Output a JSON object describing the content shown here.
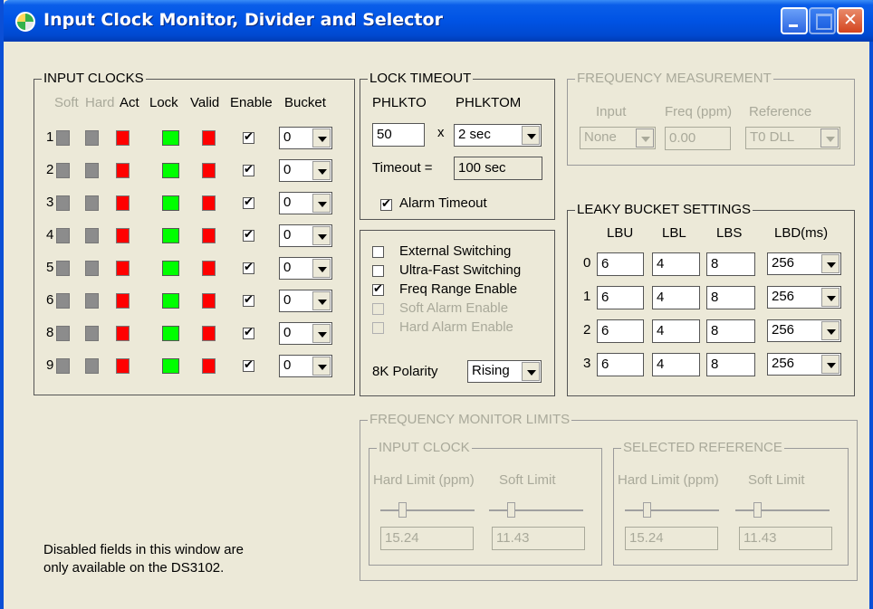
{
  "window": {
    "title": "Input Clock Monitor, Divider and Selector",
    "accent": "#0054e3",
    "face_color": "#ece9d8"
  },
  "input_clocks": {
    "label": "INPUT CLOCKS",
    "headers": [
      "Soft",
      "Hard",
      "Act",
      "Lock",
      "Valid",
      "Enable",
      "Bucket"
    ],
    "rows": [
      {
        "num": "1",
        "soft": "gray",
        "hard": "gray",
        "act": "red",
        "lock": "green",
        "valid": "red",
        "enable": true,
        "bucket": "0"
      },
      {
        "num": "2",
        "soft": "gray",
        "hard": "gray",
        "act": "red",
        "lock": "green",
        "valid": "red",
        "enable": true,
        "bucket": "0"
      },
      {
        "num": "3",
        "soft": "gray",
        "hard": "gray",
        "act": "red",
        "lock": "green",
        "valid": "red",
        "enable": true,
        "bucket": "0"
      },
      {
        "num": "4",
        "soft": "gray",
        "hard": "gray",
        "act": "red",
        "lock": "green",
        "valid": "red",
        "enable": true,
        "bucket": "0"
      },
      {
        "num": "5",
        "soft": "gray",
        "hard": "gray",
        "act": "red",
        "lock": "green",
        "valid": "red",
        "enable": true,
        "bucket": "0"
      },
      {
        "num": "6",
        "soft": "gray",
        "hard": "gray",
        "act": "red",
        "lock": "green",
        "valid": "red",
        "enable": true,
        "bucket": "0"
      },
      {
        "num": "8",
        "soft": "gray",
        "hard": "gray",
        "act": "red",
        "lock": "green",
        "valid": "red",
        "enable": true,
        "bucket": "0"
      },
      {
        "num": "9",
        "soft": "gray",
        "hard": "gray",
        "act": "red",
        "lock": "green",
        "valid": "red",
        "enable": true,
        "bucket": "0"
      }
    ]
  },
  "lock_timeout": {
    "label": "LOCK TIMEOUT",
    "phlkto_label": "PHLKTO",
    "phlktom_label": "PHLKTOM",
    "phlkto_value": "50",
    "times": "x",
    "phlktom_value": "2 sec",
    "timeout_label": "Timeout =",
    "timeout_value": "100 sec",
    "alarm_timeout_label": "Alarm Timeout",
    "alarm_timeout_checked": true
  },
  "switching": {
    "items": [
      {
        "label": "External Switching",
        "checked": false,
        "enabled": true
      },
      {
        "label": "Ultra-Fast Switching",
        "checked": false,
        "enabled": true
      },
      {
        "label": "Freq Range Enable",
        "checked": true,
        "enabled": true
      },
      {
        "label": "Soft Alarm Enable",
        "checked": false,
        "enabled": false
      },
      {
        "label": "Hard Alarm Enable",
        "checked": false,
        "enabled": false
      }
    ],
    "polarity_label": "8K Polarity",
    "polarity_value": "Rising"
  },
  "frequency_measurement": {
    "label": "FREQUENCY MEASUREMENT",
    "input_label": "Input",
    "freq_label": "Freq (ppm)",
    "reference_label": "Reference",
    "input_value": "None",
    "freq_value": "0.00",
    "reference_value": "T0 DLL"
  },
  "leaky_bucket": {
    "label": "LEAKY BUCKET SETTINGS",
    "headers": [
      "LBU",
      "LBL",
      "LBS",
      "LBD(ms)"
    ],
    "rows": [
      {
        "num": "0",
        "lbu": "6",
        "lbl": "4",
        "lbs": "8",
        "lbd": "256"
      },
      {
        "num": "1",
        "lbu": "6",
        "lbl": "4",
        "lbs": "8",
        "lbd": "256"
      },
      {
        "num": "2",
        "lbu": "6",
        "lbl": "4",
        "lbs": "8",
        "lbd": "256"
      },
      {
        "num": "3",
        "lbu": "6",
        "lbl": "4",
        "lbs": "8",
        "lbd": "256"
      }
    ]
  },
  "freq_monitor_limits": {
    "label": "FREQUENCY MONITOR LIMITS",
    "input_clock": {
      "label": "INPUT CLOCK",
      "hard_label": "Hard Limit (ppm)",
      "soft_label": "Soft Limit",
      "hard_value": "15.24",
      "soft_value": "11.43"
    },
    "selected_reference": {
      "label": "SELECTED REFERENCE",
      "hard_label": "Hard Limit (ppm)",
      "soft_label": "Soft Limit",
      "hard_value": "15.24",
      "soft_value": "11.43"
    }
  },
  "note": {
    "line1": "Disabled fields in this window are",
    "line2": "only available on the DS3102."
  }
}
